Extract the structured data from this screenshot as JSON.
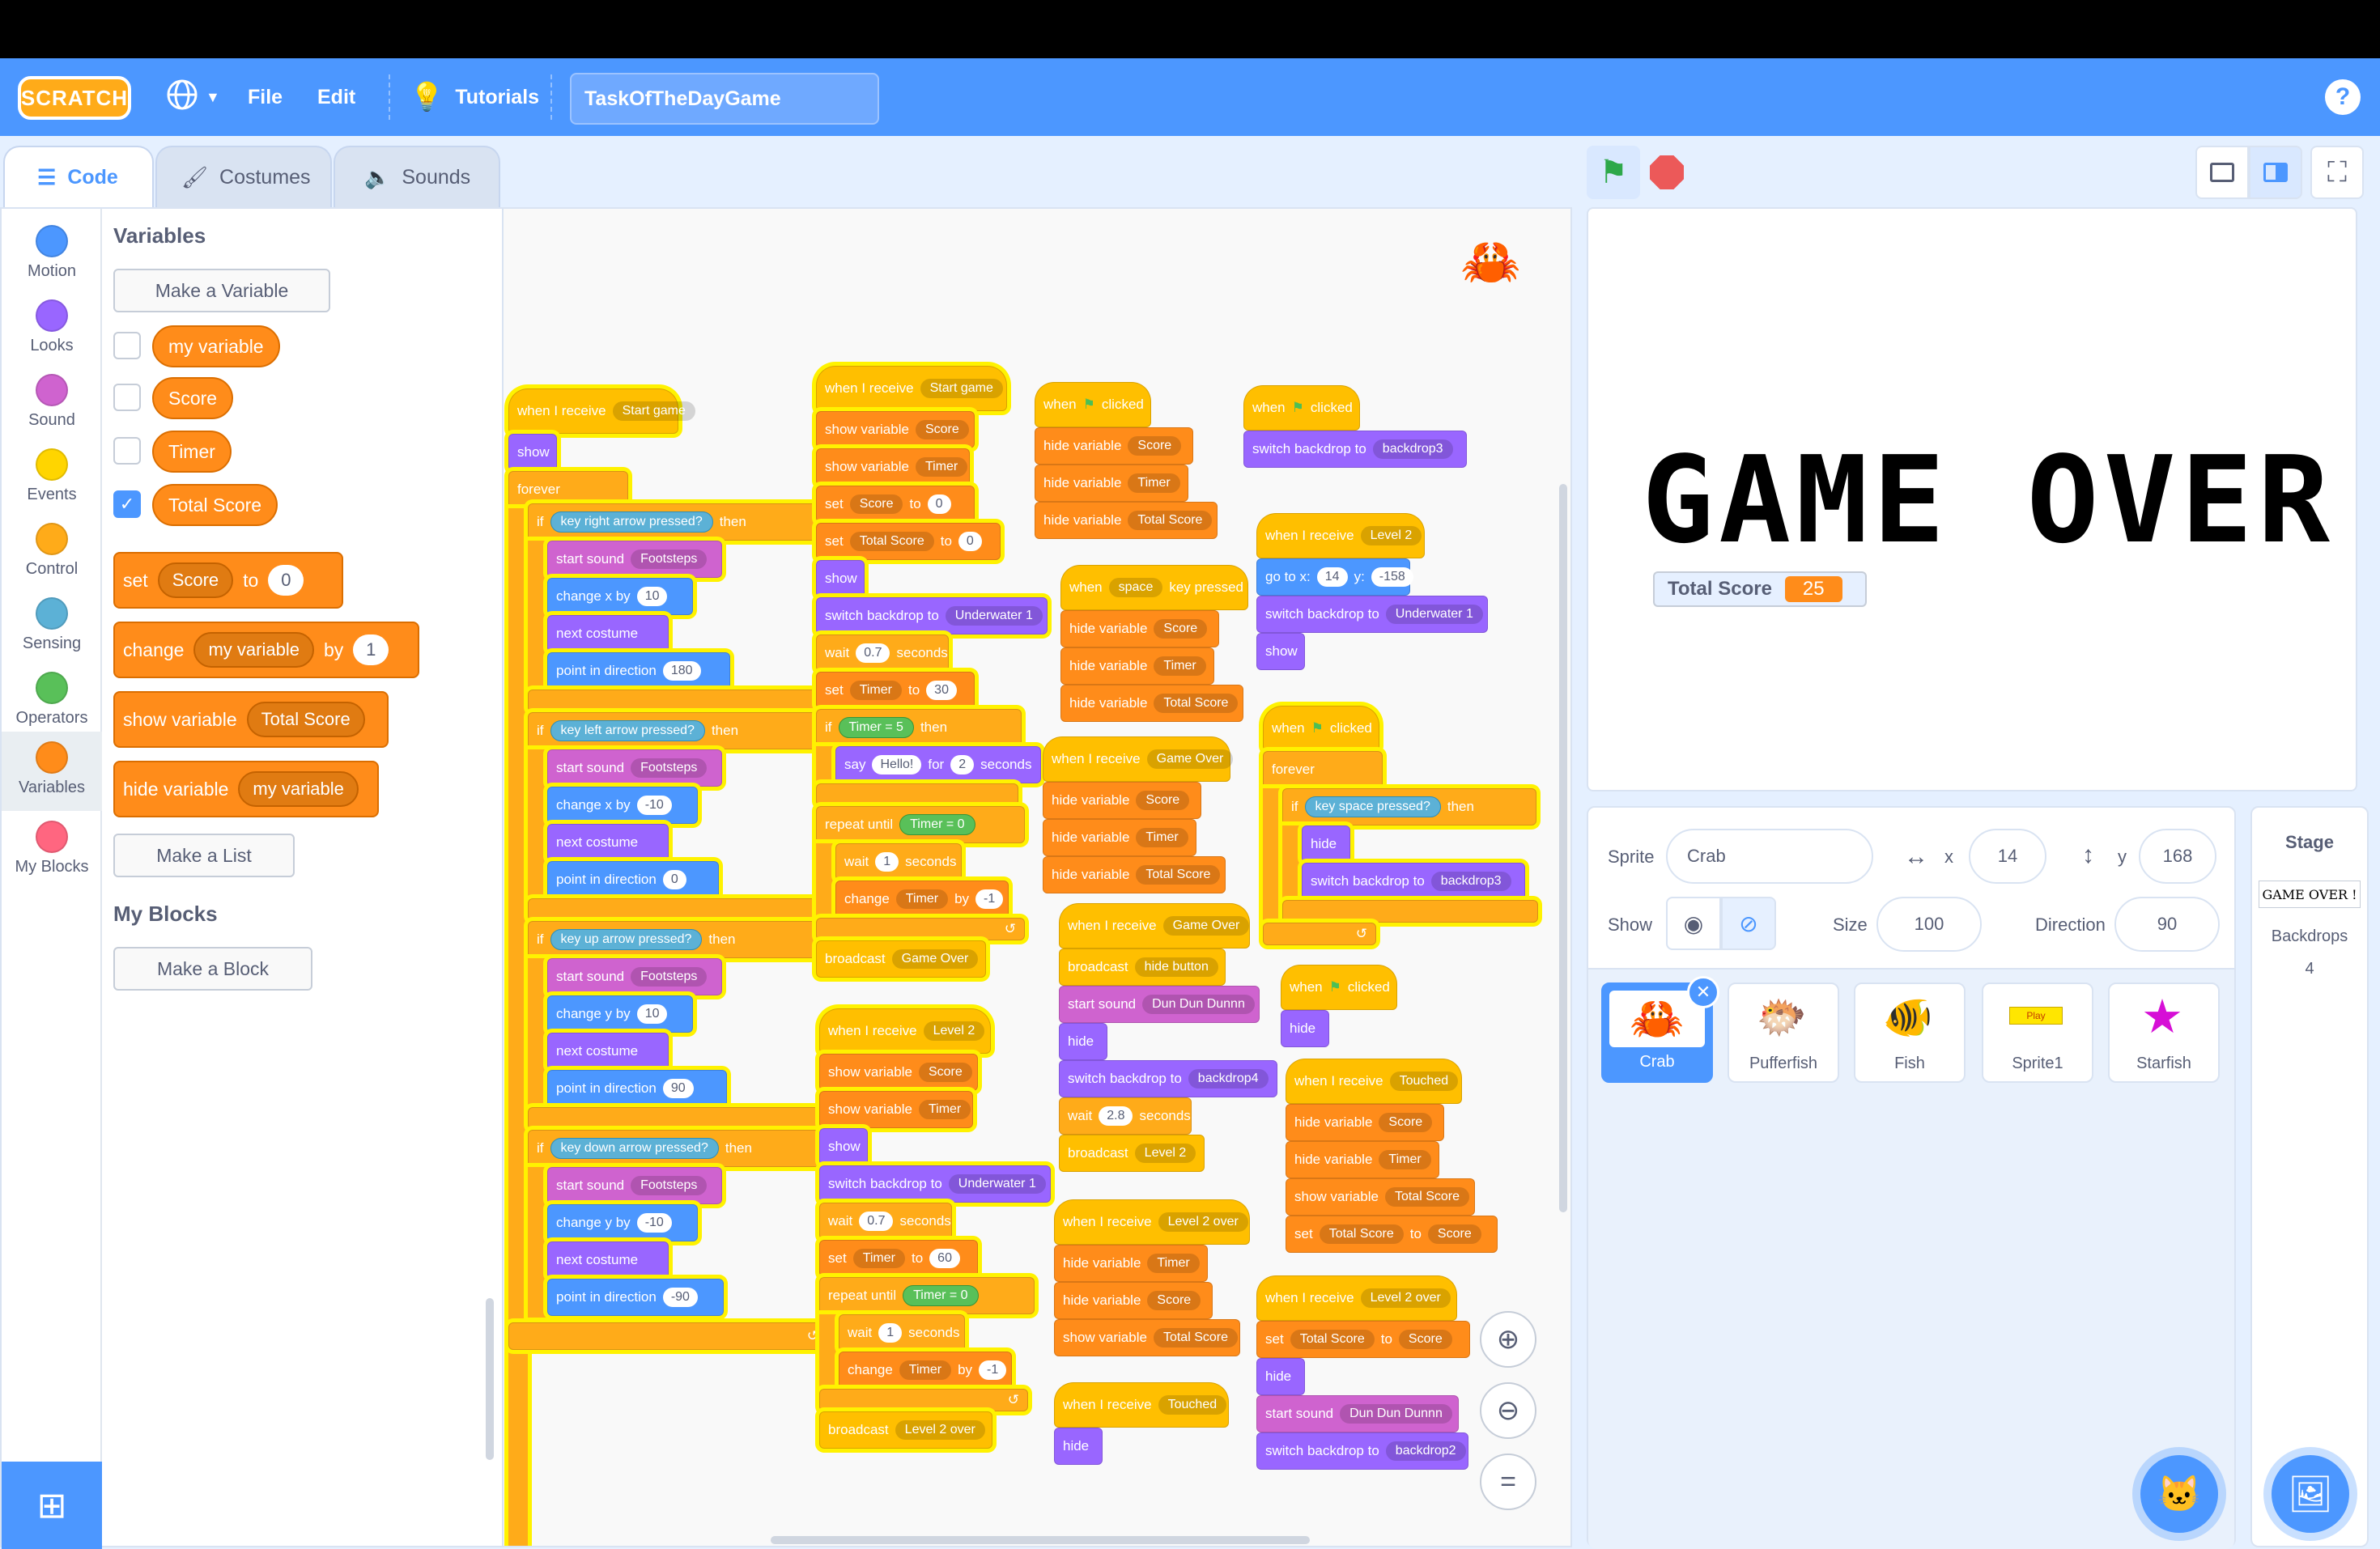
{
  "menubar": {
    "logo": "SCRATCH",
    "file": "File",
    "edit": "Edit",
    "tutorials": "Tutorials",
    "project_title": "TaskOfTheDayGame",
    "help": "?"
  },
  "tabs": {
    "code": "Code",
    "costumes": "Costumes",
    "sounds": "Sounds"
  },
  "categories": [
    {
      "label": "Motion",
      "color": "#4c97ff"
    },
    {
      "label": "Looks",
      "color": "#9966ff"
    },
    {
      "label": "Sound",
      "color": "#cf63cf"
    },
    {
      "label": "Events",
      "color": "#ffd500"
    },
    {
      "label": "Control",
      "color": "#ffab19"
    },
    {
      "label": "Sensing",
      "color": "#5cb1d6"
    },
    {
      "label": "Operators",
      "color": "#59c059"
    },
    {
      "label": "Variables",
      "color": "#ff8c1a"
    },
    {
      "label": "My Blocks",
      "color": "#ff6680"
    }
  ],
  "palette": {
    "variables_heading": "Variables",
    "make_variable": "Make a Variable",
    "vars": [
      {
        "name": "my variable",
        "checked": false
      },
      {
        "name": "Score",
        "checked": false
      },
      {
        "name": "Timer",
        "checked": false
      },
      {
        "name": "Total Score",
        "checked": true
      }
    ],
    "set_block": {
      "kw": "set",
      "var": "Score",
      "to": "to",
      "val": "0"
    },
    "change_block": {
      "kw": "change",
      "var": "my variable",
      "by": "by",
      "val": "1"
    },
    "show_block": {
      "kw": "show variable",
      "var": "Total Score"
    },
    "hide_block": {
      "kw": "hide variable",
      "var": "my variable"
    },
    "make_list": "Make a List",
    "myblocks_heading": "My Blocks",
    "make_block": "Make a Block"
  },
  "scripts": {
    "s1": {
      "hat": "when I receive",
      "hat_msg": "Start game",
      "show": "show",
      "forever": "forever",
      "if1": {
        "key": "right arrow",
        "start_sound": "Footsteps",
        "move": "change x by",
        "move_val": "10",
        "dir_val": "180"
      },
      "if2": {
        "key": "left arrow",
        "start_sound": "Footsteps",
        "move": "change x by",
        "move_val": "-10",
        "dir_val": "0"
      },
      "if3": {
        "key": "up arrow",
        "start_sound": "Footsteps",
        "move": "change y by",
        "move_val": "10",
        "dir_val": "90"
      },
      "if4": {
        "key": "down arrow",
        "start_sound": "Footsteps",
        "move": "change y by",
        "move_val": "-10",
        "dir_val": "-90"
      },
      "if_kw": "if",
      "key_kw": "key",
      "pressed_kw": "pressed?",
      "then_kw": "then",
      "start_sound_kw": "start sound",
      "next_costume": "next costume",
      "point_kw": "point in direction"
    },
    "s2": {
      "hat": "when I receive",
      "hat_msg": "Start game",
      "show_var1": "show variable",
      "show_var1_v": "Score",
      "show_var2": "show variable",
      "show_var2_v": "Timer",
      "set1": "set",
      "set1_v": "Score",
      "set1_to": "to",
      "set1_val": "0",
      "set2": "set",
      "set2_v": "Total Score",
      "set2_to": "to",
      "set2_val": "0",
      "show": "show",
      "switch": "switch backdrop to",
      "switch_v": "Underwater 1",
      "wait": "wait",
      "wait_val": "0.7",
      "seconds": "seconds",
      "set3": "set",
      "set3_v": "Timer",
      "set3_to": "to",
      "set3_val": "30",
      "if_kw": "if",
      "cond_v": "Timer",
      "eq": "=",
      "cond_val": "5",
      "then_kw": "then",
      "say": "say",
      "say_v": "Hello!",
      "for": "for",
      "say_val": "2",
      "say_sec": "seconds",
      "repeat": "repeat until",
      "r_v": "Timer",
      "r_eq": "=",
      "r_val": "0",
      "wait2": "wait",
      "wait2_val": "1",
      "wait2_sec": "seconds",
      "change": "change",
      "change_v": "Timer",
      "change_by": "by",
      "change_val": "-1",
      "broadcast": "broadcast",
      "broadcast_v": "Game Over"
    },
    "s3": {
      "hat": "when I receive",
      "hat_msg": "Level 2",
      "show_var1": "show variable",
      "show_var1_v": "Score",
      "show_var2": "show variable",
      "show_var2_v": "Timer",
      "show": "show",
      "switch": "switch backdrop to",
      "switch_v": "Underwater 1",
      "wait": "wait",
      "wait_val": "0.7",
      "seconds": "seconds",
      "set": "set",
      "set_v": "Timer",
      "set_to": "to",
      "set_val": "60",
      "repeat": "repeat until",
      "r_v": "Timer",
      "r_eq": "=",
      "r_val": "0",
      "wait2": "wait",
      "wait2_val": "1",
      "wait2_sec": "seconds",
      "change": "change",
      "change_v": "Timer",
      "change_by": "by",
      "change_val": "-1",
      "broadcast": "broadcast",
      "broadcast_v": "Level 2 over"
    },
    "s4": {
      "hat": "when",
      "hat2": "clicked",
      "hide1": "hide variable",
      "hide1_v": "Score",
      "hide2": "hide variable",
      "hide2_v": "Timer",
      "hide3": "hide variable",
      "hide3_v": "Total Score"
    },
    "s5": {
      "hat": "when",
      "key": "space",
      "hat2": "key pressed",
      "hide1": "hide variable",
      "hide1_v": "Score",
      "hide2": "hide variable",
      "hide2_v": "Timer",
      "hide3": "hide variable",
      "hide3_v": "Total Score"
    },
    "s6": {
      "hat": "when I receive",
      "hat_msg": "Game Over",
      "hide1": "hide variable",
      "hide1_v": "Score",
      "hide2": "hide variable",
      "hide2_v": "Timer",
      "hide3": "hide variable",
      "hide3_v": "Total Score"
    },
    "s7": {
      "hat": "when I receive",
      "hat_msg": "Game Over",
      "broadcast": "broadcast",
      "broadcast_v": "hide button",
      "sound": "start sound",
      "sound_v": "Dun Dun Dunnn",
      "hide": "hide",
      "switch": "switch backdrop to",
      "switch_v": "backdrop4",
      "wait": "wait",
      "wait_val": "2.8",
      "seconds": "seconds",
      "broadcast2": "broadcast",
      "broadcast2_v": "Level 2"
    },
    "s8": {
      "hat": "when I receive",
      "hat_msg": "Level 2 over",
      "hide1": "hide variable",
      "hide1_v": "Timer",
      "hide2": "hide variable",
      "hide2_v": "Score",
      "show1": "show variable",
      "show1_v": "Total Score"
    },
    "s9": {
      "hat": "when I receive",
      "hat_msg": "Touched",
      "hide": "hide"
    },
    "s10": {
      "hat": "when",
      "hat2": "clicked",
      "switch": "switch backdrop to",
      "switch_v": "backdrop3"
    },
    "s11": {
      "hat": "when I receive",
      "hat_msg": "Level 2",
      "goto": "go to x:",
      "goto_x": "14",
      "goto_y_kw": "y:",
      "goto_y": "-158",
      "switch": "switch backdrop to",
      "switch_v": "Underwater 1",
      "show": "show"
    },
    "s12": {
      "hat": "when",
      "hat2": "clicked",
      "forever": "forever",
      "if_kw": "if",
      "key_kw": "key",
      "key": "space",
      "pressed": "pressed?",
      "then_kw": "then",
      "hide": "hide",
      "switch": "switch backdrop to",
      "switch_v": "backdrop3"
    },
    "s13": {
      "hat": "when",
      "hat2": "clicked",
      "hide": "hide"
    },
    "s14": {
      "hat": "when I receive",
      "hat_msg": "Touched",
      "hide1": "hide variable",
      "hide1_v": "Score",
      "hide2": "hide variable",
      "hide2_v": "Timer",
      "show1": "show variable",
      "show1_v": "Total Score",
      "set": "set",
      "set_v": "Total Score",
      "set_to": "to",
      "set_val": "Score"
    },
    "s15": {
      "hat": "when I receive",
      "hat_msg": "Level 2 over",
      "set": "set",
      "set_v": "Total Score",
      "set_to": "to",
      "set_val": "Score",
      "hide": "hide",
      "sound": "start sound",
      "sound_v": "Dun Dun Dunnn",
      "switch": "switch backdrop to",
      "switch_v": "backdrop2"
    }
  },
  "stage": {
    "game_over_text": "GAME OVER !",
    "monitor_label": "Total Score",
    "monitor_value": "25"
  },
  "sprite_info": {
    "sprite_label": "Sprite",
    "sprite_name": "Crab",
    "x_label": "x",
    "x_val": "14",
    "y_label": "y",
    "y_val": "168",
    "show_label": "Show",
    "size_label": "Size",
    "size_val": "100",
    "direction_label": "Direction",
    "direction_val": "90"
  },
  "sprites": [
    {
      "name": "Crab",
      "selected": true
    },
    {
      "name": "Pufferfish",
      "selected": false
    },
    {
      "name": "Fish",
      "selected": false
    },
    {
      "name": "Sprite1",
      "selected": false
    },
    {
      "name": "Starfish",
      "selected": false
    }
  ],
  "sprite1_thumb_text": "Play",
  "stage_panel": {
    "title": "Stage",
    "thumb_text": "GAME OVER !",
    "backdrops_label": "Backdrops",
    "backdrops_count": "4"
  },
  "colors": {
    "accent": "#4c97ff",
    "events": "#ffbf00",
    "variables": "#ff8c1a",
    "control": "#ffab19",
    "looks": "#9966ff",
    "sound": "#cf63cf",
    "sensing": "#5cb1d6",
    "operators": "#59c059",
    "motion": "#4c97ff"
  }
}
